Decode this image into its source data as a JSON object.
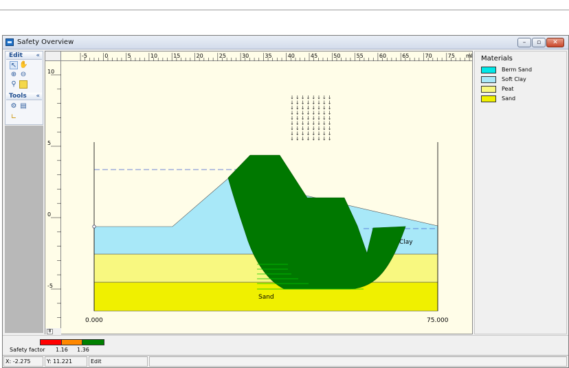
{
  "window": {
    "title": "Safety Overview",
    "minimize": "–",
    "maximize": "▫",
    "close": "✕"
  },
  "toolpanel": {
    "edit_header": "Edit",
    "tools_header": "Tools",
    "collapse_glyph": "«"
  },
  "ruler": {
    "x_ticks": [
      "-5",
      "0",
      "5",
      "10",
      "15",
      "20",
      "25",
      "30",
      "35",
      "40",
      "45",
      "50",
      "55",
      "60",
      "65",
      "70",
      "75",
      "80"
    ],
    "x_unit": "m",
    "y_ticks": [
      "10",
      "5",
      "0",
      "-5"
    ]
  },
  "canvas_labels": {
    "clay": "Clay",
    "sand": "Sand",
    "left_coord": "0.000",
    "right_coord": "75.000"
  },
  "materials": {
    "title": "Materials",
    "items": [
      {
        "name": "Berm Sand",
        "color": "#00e8e8"
      },
      {
        "name": "Soft Clay",
        "color": "#a8e8f8"
      },
      {
        "name": "Peat",
        "color": "#f8f880"
      },
      {
        "name": "Sand",
        "color": "#f0f000"
      }
    ]
  },
  "safety_factor": {
    "label": "Safety factor",
    "thresholds": [
      "1.16",
      "1.36"
    ],
    "colors": [
      "#ff0000",
      "#ff8800",
      "#008000"
    ]
  },
  "status": {
    "x": "X: -2.275",
    "y": "Y: 11.221",
    "mode": "Edit"
  },
  "colors": {
    "slip_zone": "#007800",
    "water_line": "#4060d0"
  }
}
